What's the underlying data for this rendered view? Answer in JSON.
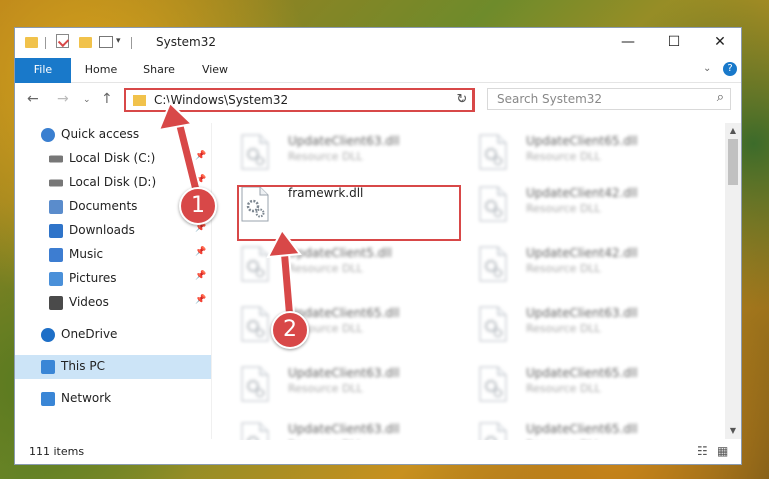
{
  "window": {
    "title": "System32"
  },
  "window_controls": {
    "minimize": "—",
    "maximize": "☐",
    "close": "✕"
  },
  "ribbon": {
    "tabs": [
      "File",
      "Home",
      "Share",
      "View"
    ]
  },
  "address": {
    "path": "C:\\Windows\\System32",
    "search_placeholder": "Search System32"
  },
  "nav_pane": {
    "items": [
      {
        "label": "Quick access",
        "icon": "star-icon"
      },
      {
        "label": "Local Disk (C:)",
        "icon": "drive-icon",
        "pinned": true
      },
      {
        "label": "Local Disk (D:)",
        "icon": "drive-icon",
        "pinned": true
      },
      {
        "label": "Documents",
        "icon": "documents-icon",
        "pinned": true
      },
      {
        "label": "Downloads",
        "icon": "downloads-icon",
        "pinned": true
      },
      {
        "label": "Music",
        "icon": "music-icon",
        "pinned": true
      },
      {
        "label": "Pictures",
        "icon": "pictures-icon",
        "pinned": true
      },
      {
        "label": "Videos",
        "icon": "videos-icon",
        "pinned": true
      },
      {
        "label": "OneDrive",
        "icon": "cloud-icon"
      },
      {
        "label": "This PC",
        "icon": "computer-icon",
        "selected": true
      },
      {
        "label": "Network",
        "icon": "network-icon"
      }
    ]
  },
  "files": [
    {
      "name": "UpdateClient63.dll",
      "desc": "Resource DLL",
      "blurred": true
    },
    {
      "name": "UpdateClient65.dll",
      "desc": "Resource DLL",
      "blurred": true
    },
    {
      "name": "framewrk.dll",
      "desc": "",
      "blurred": false
    },
    {
      "name": "UpdateClient42.dll",
      "desc": "Resource DLL",
      "blurred": true
    },
    {
      "name": "UpdateClient5.dll",
      "desc": "Resource DLL",
      "blurred": true
    },
    {
      "name": "UpdateClient42.dll",
      "desc": "Resource DLL",
      "blurred": true
    },
    {
      "name": "UpdateClient65.dll",
      "desc": "Resource DLL",
      "blurred": true
    },
    {
      "name": "UpdateClient63.dll",
      "desc": "Resource DLL",
      "blurred": true
    },
    {
      "name": "UpdateClient63.dll",
      "desc": "Resource DLL",
      "blurred": true
    },
    {
      "name": "UpdateClient65.dll",
      "desc": "Resource DLL",
      "blurred": true
    },
    {
      "name": "UpdateClient63.dll",
      "desc": "Resource DLL",
      "blurred": true
    },
    {
      "name": "UpdateClient65.dll",
      "desc": "Resource DLL",
      "blurred": true
    }
  ],
  "status": {
    "item_count": "111 items"
  },
  "callouts": [
    "1",
    "2"
  ],
  "colors": {
    "accent": "#1979ca",
    "highlight": "#d84848",
    "selected": "#cce4f7"
  }
}
